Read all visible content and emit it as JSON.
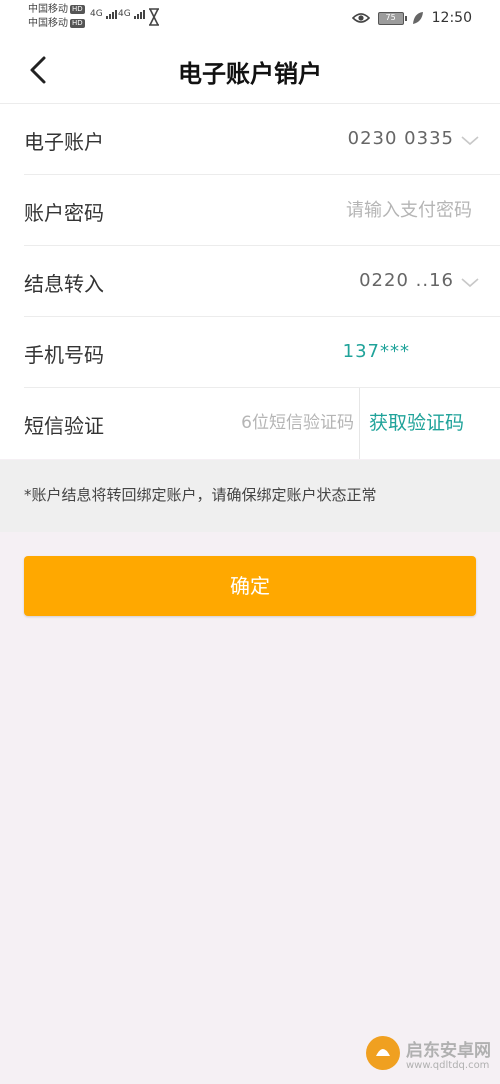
{
  "status_bar": {
    "carrier_1": "中国移动",
    "carrier_2": "中国移动",
    "hd_badge": "HD",
    "network_1": "4G",
    "network_2": "4G",
    "battery": "75",
    "time": "12:50"
  },
  "header": {
    "title": "电子账户销户",
    "back_icon": "chevron-left-icon"
  },
  "form": {
    "account": {
      "label": "电子账户",
      "value": "0230    0335"
    },
    "password": {
      "label": "账户密码",
      "placeholder": "请输入支付密码",
      "value": ""
    },
    "interest": {
      "label": "结息转入",
      "value": "0220    ..16"
    },
    "phone": {
      "label": "手机号码",
      "value": "137***"
    },
    "sms": {
      "label": "短信验证",
      "placeholder": "6位短信验证码",
      "value": "",
      "get_code_label": "获取验证码"
    }
  },
  "notice": "*账户结息将转回绑定账户，请确保绑定账户状态正常",
  "confirm_label": "确定",
  "colors": {
    "accent_orange": "#ffa800",
    "accent_teal": "#20a39a"
  }
}
